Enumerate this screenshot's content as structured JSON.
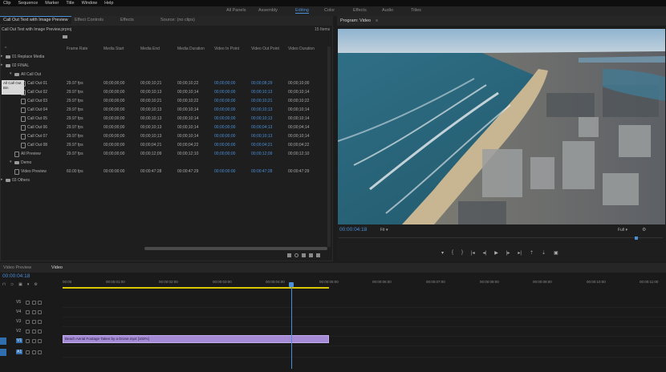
{
  "menu": [
    "Clip",
    "Sequence",
    "Marker",
    "Title",
    "Window",
    "Help"
  ],
  "workspaces": [
    "All Panels",
    "Assembly",
    "Editing",
    "Color",
    "Effects",
    "Audio",
    "Titles"
  ],
  "workspace_active": "Editing",
  "project_tabs": [
    "Call Out Text with Image Preview",
    "Effect Controls",
    "Effects",
    "Source: (no clips)"
  ],
  "project_path": "Call Out Text with Image Preview.prproj",
  "item_count": "15 Items",
  "columns": [
    "Frame Rate",
    "Media Start",
    "Media End",
    "Media Duration",
    "Video In Point",
    "Video Out Point",
    "Video Duration"
  ],
  "tooltip": [
    "All Call Out",
    "Bin"
  ],
  "rows": [
    {
      "name": "01 Replace Media",
      "type": "folder",
      "indent": 0,
      "vals": [
        "",
        "",
        "",
        "",
        "",
        "",
        ""
      ]
    },
    {
      "name": "02 FINAL",
      "type": "folder",
      "indent": 0,
      "vals": [
        "",
        "",
        "",
        "",
        "",
        "",
        ""
      ]
    },
    {
      "name": "All Call Out",
      "type": "folder",
      "indent": 1,
      "vals": [
        "",
        "",
        "",
        "",
        "",
        "",
        ""
      ]
    },
    {
      "name": "Call Out 01",
      "type": "clip",
      "indent": 2,
      "vals": [
        "29.97 fps",
        "00;00;00;00",
        "00;00;10;21",
        "00;00;10;22",
        "00;00;00;00",
        "00;00;08;29",
        "00;00;10;00"
      ]
    },
    {
      "name": "Call Out 02",
      "type": "clip",
      "indent": 2,
      "vals": [
        "29.97 fps",
        "00;00;00;00",
        "00;00;10;13",
        "00;00;10;14",
        "00;00;00;00",
        "00;00;10;13",
        "00;00;10;14"
      ]
    },
    {
      "name": "Call Out 03",
      "type": "clip",
      "indent": 2,
      "vals": [
        "29.97 fps",
        "00;00;00;00",
        "00;00;10;21",
        "00;00;10;22",
        "00;00;00;00",
        "00;00;10;21",
        "00;00;10;22"
      ]
    },
    {
      "name": "Call Out 04",
      "type": "clip",
      "indent": 2,
      "vals": [
        "29.97 fps",
        "00;00;00;00",
        "00;00;10;13",
        "00;00;10;14",
        "00;00;00;00",
        "00;00;10;13",
        "00;00;10;14"
      ]
    },
    {
      "name": "Call Out 05",
      "type": "clip",
      "indent": 2,
      "vals": [
        "29.97 fps",
        "00;00;00;00",
        "00;00;10;13",
        "00;00;10;14",
        "00;00;00;00",
        "00;00;10;13",
        "00;00;10;14"
      ]
    },
    {
      "name": "Call Out 06",
      "type": "clip",
      "indent": 2,
      "vals": [
        "29.97 fps",
        "00;00;00;00",
        "00;00;10;13",
        "00;00;10;14",
        "00;00;00;00",
        "00;00;04;13",
        "00;00;04;14"
      ]
    },
    {
      "name": "Call Out 07",
      "type": "clip",
      "indent": 2,
      "vals": [
        "29.97 fps",
        "00;00;00;00",
        "00;00;10;13",
        "00;00;10;14",
        "00;00;00;00",
        "00;00;10;13",
        "00;00;10;14"
      ]
    },
    {
      "name": "Call Out 08",
      "type": "clip",
      "indent": 2,
      "vals": [
        "29.97 fps",
        "00;00;00;00",
        "00;00;04;21",
        "00;00;04;22",
        "00;00;00;00",
        "00;00;04;21",
        "00;00;04;22"
      ]
    },
    {
      "name": "All Preview",
      "type": "clip",
      "indent": 1,
      "vals": [
        "29.97 fps",
        "00;00;00;00",
        "00;00;12;09",
        "00;00;12;10",
        "00;00;00;00",
        "00;00;12;09",
        "00;00;12;10"
      ]
    },
    {
      "name": "Demo",
      "type": "folder",
      "indent": 1,
      "vals": [
        "",
        "",
        "",
        "",
        "",
        "",
        ""
      ]
    },
    {
      "name": "Video Preview",
      "type": "clip",
      "indent": 1,
      "vals": [
        "60.00 fps",
        "00:00:00:00",
        "00:00:47:28",
        "00:00:47:29",
        "00:00:00:00",
        "00:00:47:28",
        "00:00:47:29"
      ]
    },
    {
      "name": "03 Others",
      "type": "folder",
      "indent": 0,
      "vals": [
        "",
        "",
        "",
        "",
        "",
        "",
        ""
      ]
    }
  ],
  "program_tab": "Program: Video",
  "program_timecode": "00:00:04:18",
  "fit_label": "Fit",
  "full_label": "Full",
  "timeline_tabs": [
    "Video Preview",
    "Video"
  ],
  "timeline_timecode": "00:00:04:18",
  "ruler": [
    "00:00",
    "00:00:01:00",
    "00:00:02:00",
    "00:00:03:00",
    "00:00:04:00",
    "00:00:05:00",
    "00:00:06:00",
    "00:00:07:00",
    "00:00:08:00",
    "00:00:09:00",
    "00:00:10:00",
    "00:00:11:00"
  ],
  "tracks": [
    "V5",
    "V4",
    "V3",
    "V2",
    "V1",
    "A1"
  ],
  "clip_label": "Beach Aerial Footage Taken by a Drone.mp4 [102%]",
  "colors": {
    "accent": "#4a90d9",
    "clip": "#a58bd6",
    "playhead": "#4a90d9"
  }
}
